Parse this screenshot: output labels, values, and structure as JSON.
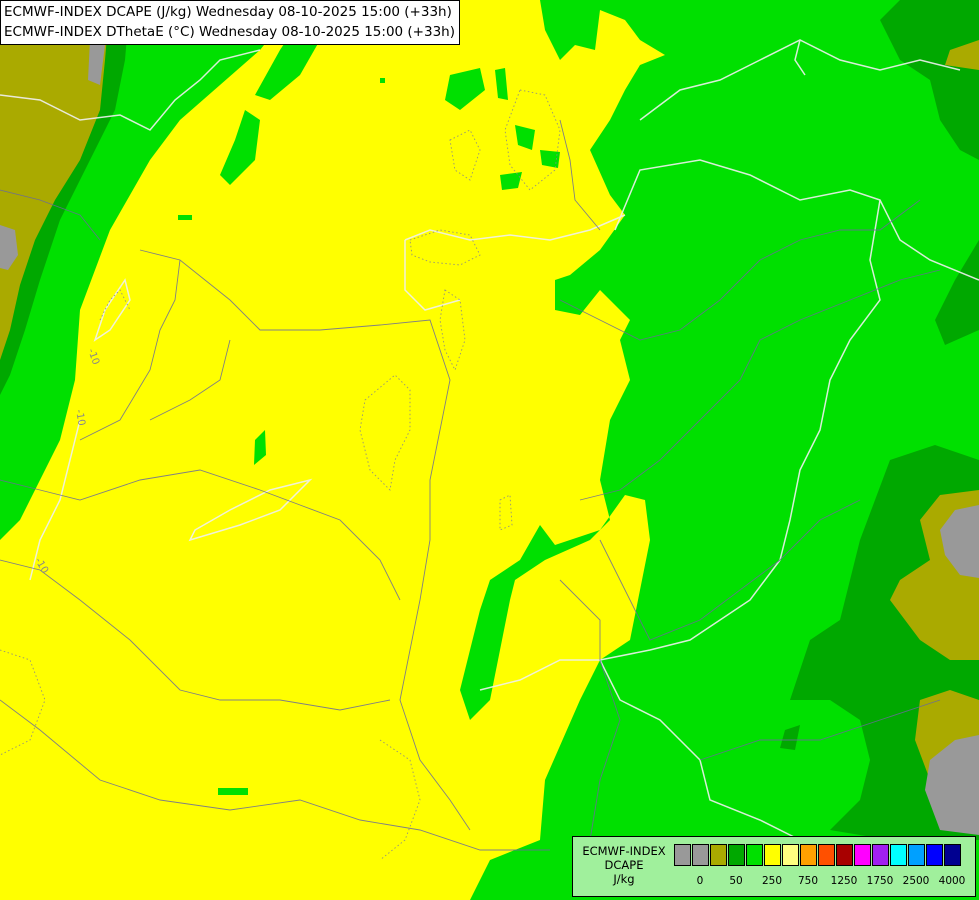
{
  "header": {
    "line1": "ECMWF-INDEX DCAPE (J/kg) Wednesday 08-10-2025 15:00 (+33h)",
    "line2": "ECMWF-INDEX DThetaE (°C) Wednesday 08-10-2025 15:00 (+33h)"
  },
  "contour_labels": [
    "-10",
    "-10",
    "-10"
  ],
  "legend": {
    "title": [
      "ECMWF-INDEX",
      "DCAPE",
      "J/kg"
    ],
    "colors": [
      "#999999",
      "#999999",
      "#aaaa00",
      "#00a800",
      "#00e000",
      "#ffff00",
      "#ffff80",
      "#ffa000",
      "#ff5000",
      "#a80000",
      "#ff00ff",
      "#a020f0",
      "#00ffff",
      "#00a0ff",
      "#0000ff",
      "#000090"
    ],
    "ticks": [
      "0",
      "50",
      "250",
      "750",
      "1250",
      "1750",
      "2500",
      "4000"
    ]
  },
  "colors": {
    "dark_green": "#00a800",
    "green": "#00e000",
    "yellow": "#ffff00",
    "olive": "#aaaa00",
    "grey": "#999999",
    "legend_bg": "#a0f09c"
  }
}
